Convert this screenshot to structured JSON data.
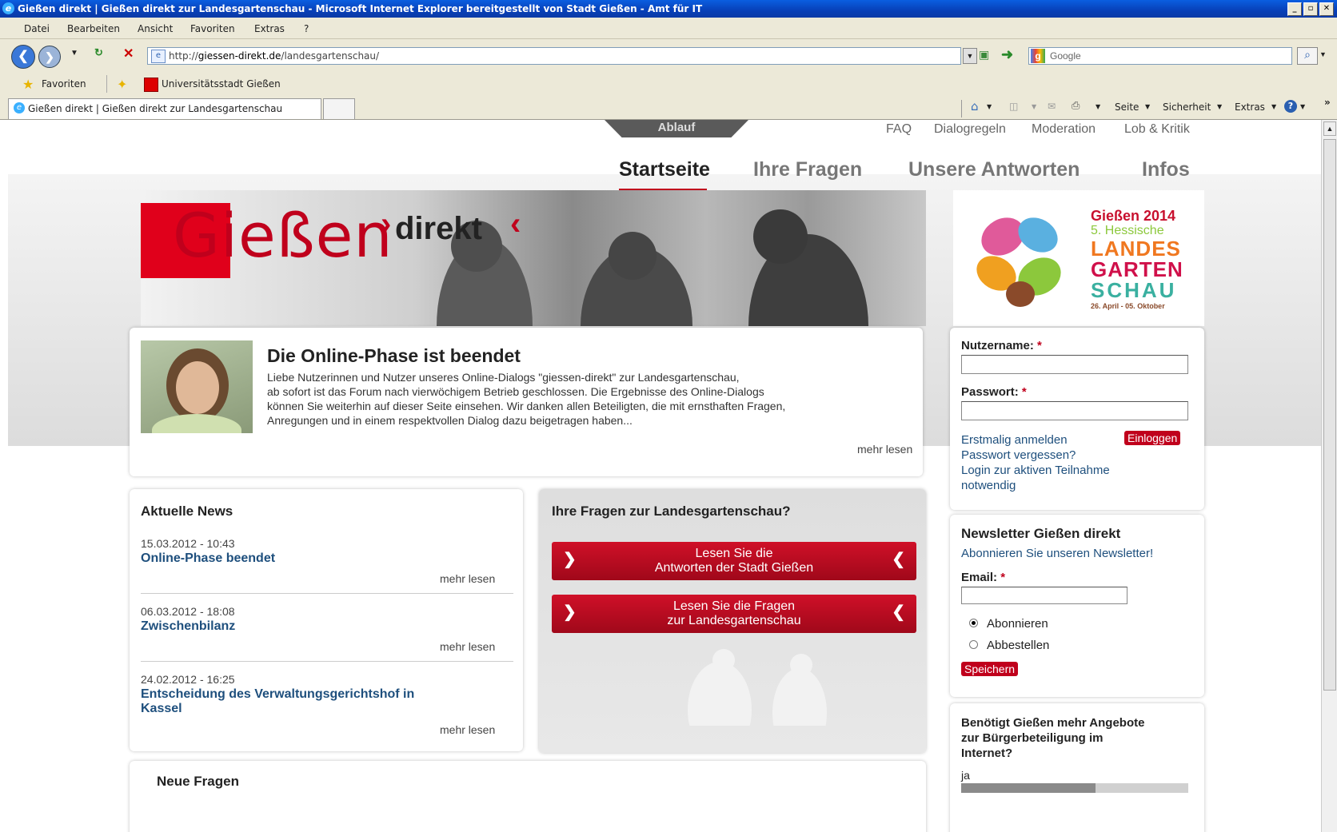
{
  "browser": {
    "title": "Gießen direkt | Gießen direkt zur Landesgartenschau - Microsoft Internet Explorer bereitgestellt von Stadt Gießen - Amt für IT",
    "menu": [
      "Datei",
      "Bearbeiten",
      "Ansicht",
      "Favoriten",
      "Extras",
      "?"
    ],
    "url_prefix": "http://",
    "url_host": "giessen-direkt.de",
    "url_path": "/landesgartenschau/",
    "search_placeholder": "Google",
    "favorites_label": "Favoriten",
    "favorite_link": "Universitätsstadt Gießen",
    "tab_title": "Gießen direkt | Gießen direkt zur Landesgartenschau",
    "toolbar_items": [
      "Seite",
      "Sicherheit",
      "Extras"
    ]
  },
  "site": {
    "flap_label": "Ablauf",
    "top_links": [
      "FAQ",
      "Dialogregeln",
      "Moderation",
      "Lob & Kritik"
    ],
    "main_nav": [
      "Startseite",
      "Ihre Fragen",
      "Unsere Antworten",
      "Infos"
    ],
    "logo_text": "Gießen",
    "logo_direkt": "direkt",
    "lgs": {
      "line1": "Gießen 2014",
      "line2": "5. Hessische",
      "line3": "LANDES",
      "line4": "GARTEN",
      "line5": "SCHAU",
      "line6": "26. April - 05. Oktober"
    }
  },
  "intro": {
    "title": "Die Online-Phase ist beendet",
    "lines": [
      "Liebe Nutzerinnen und Nutzer unseres Online-Dialogs \"giessen-direkt\" zur Landesgartenschau,",
      "ab sofort ist das Forum nach vierwöchigem Betrieb geschlossen. Die Ergebnisse des Online-Dialogs",
      "können Sie weiterhin auf dieser Seite einsehen. Wir danken allen Beteiligten, die mit ernsthaften Fragen,",
      "Anregungen und in einem respektvollen Dialog dazu beigetragen haben..."
    ],
    "more": "mehr lesen"
  },
  "login": {
    "username_label": "Nutzername:",
    "password_label": "Passwort:",
    "required": "*",
    "first_login": "Erstmalig anmelden",
    "login_button": "Einloggen",
    "forgot": "Passwort vergessen?",
    "note_line1": "Login zur aktiven Teilnahme",
    "note_line2": "notwendig"
  },
  "news": {
    "heading": "Aktuelle News",
    "items": [
      {
        "date": "15.03.2012 - 10:43",
        "title": "Online-Phase beendet",
        "more": "mehr lesen"
      },
      {
        "date": "06.03.2012 - 18:08",
        "title": "Zwischenbilanz",
        "more": "mehr lesen"
      },
      {
        "date": "24.02.2012 - 16:25",
        "title_line1": "Entscheidung des Verwaltungsgerichtshof in",
        "title_line2": "Kassel",
        "more": "mehr lesen"
      }
    ]
  },
  "questions": {
    "heading": "Ihre Fragen zur Landesgartenschau?",
    "btn1_line1": "Lesen Sie die",
    "btn1_line2": "Antworten der Stadt Gießen",
    "btn2_line1": "Lesen Sie die Fragen",
    "btn2_line2": "zur Landesgartenschau"
  },
  "newsletter": {
    "heading": "Newsletter Gießen direkt",
    "sub": "Abonnieren Sie unseren Newsletter!",
    "email_label": "Email:",
    "required": "*",
    "opt_subscribe": "Abonnieren",
    "opt_unsubscribe": "Abbestellen",
    "save": "Speichern"
  },
  "poll": {
    "line1": "Benötigt Gießen mehr Angebote",
    "line2": "zur Bürgerbeteiligung im",
    "line3": "Internet?",
    "option": "ja"
  },
  "new_questions": {
    "heading": "Neue Fragen"
  }
}
